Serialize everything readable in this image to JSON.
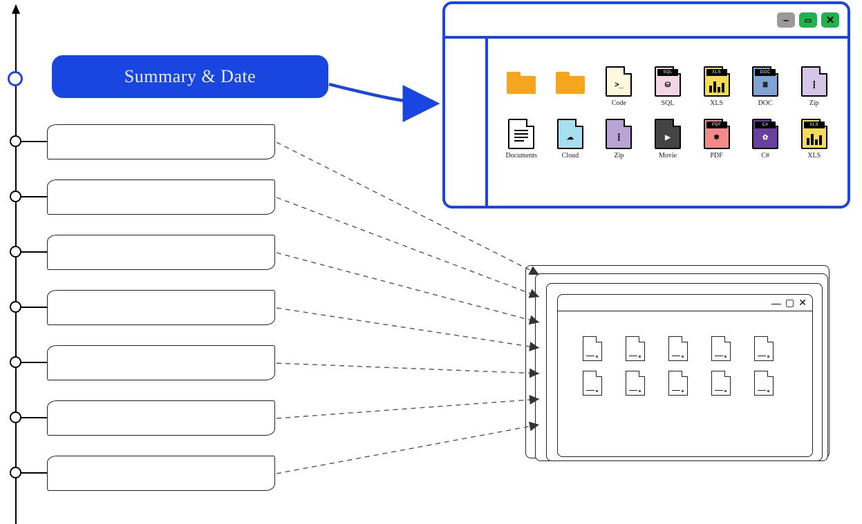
{
  "summary": {
    "title": "Summary & Date"
  },
  "timeline": {
    "entries_count": 7,
    "connects_to": "stacked-windows"
  },
  "main_window": {
    "controls": {
      "minimize": "–",
      "maximize": "▭",
      "close": "✕"
    },
    "files_row1": [
      {
        "kind": "folder",
        "label": ""
      },
      {
        "kind": "folder",
        "label": ""
      },
      {
        "kind": "code",
        "label": "Code",
        "tag": "",
        "glyph": ">_"
      },
      {
        "kind": "sql",
        "label": "SQL",
        "tag": "SQL",
        "glyph": "⛁"
      },
      {
        "kind": "xls",
        "label": "XLS",
        "tag": "XLS",
        "glyph": "▮"
      },
      {
        "kind": "doc",
        "label": "DOC",
        "tag": "DOC",
        "glyph": "≣"
      },
      {
        "kind": "zip",
        "label": "Zip",
        "tag": "",
        "glyph": "┇"
      }
    ],
    "files_row2": [
      {
        "kind": "docs",
        "label": "Documents",
        "tag": "",
        "glyph": "≣"
      },
      {
        "kind": "cloud",
        "label": "Cloud",
        "tag": "",
        "glyph": "☁"
      },
      {
        "kind": "zip2",
        "label": "Zip",
        "tag": "",
        "glyph": "┇"
      },
      {
        "kind": "movie",
        "label": "Movie",
        "tag": "",
        "glyph": "▶"
      },
      {
        "kind": "pdf",
        "label": "PDF",
        "tag": "PDF",
        "glyph": "✾"
      },
      {
        "kind": "cs",
        "label": "C#",
        "tag": "C#",
        "glyph": "✿"
      },
      {
        "kind": "xls2",
        "label": "XLS",
        "tag": "XLS",
        "glyph": "▮"
      }
    ]
  },
  "stack_window": {
    "controls": {
      "minimize": "—",
      "maximize": "▢",
      "close": "✕"
    },
    "placeholder_docs": 10
  },
  "colors": {
    "primary": "#1946e0",
    "folder": "#f6a61d",
    "green": "#23b14d",
    "grey": "#9a9a9a"
  }
}
